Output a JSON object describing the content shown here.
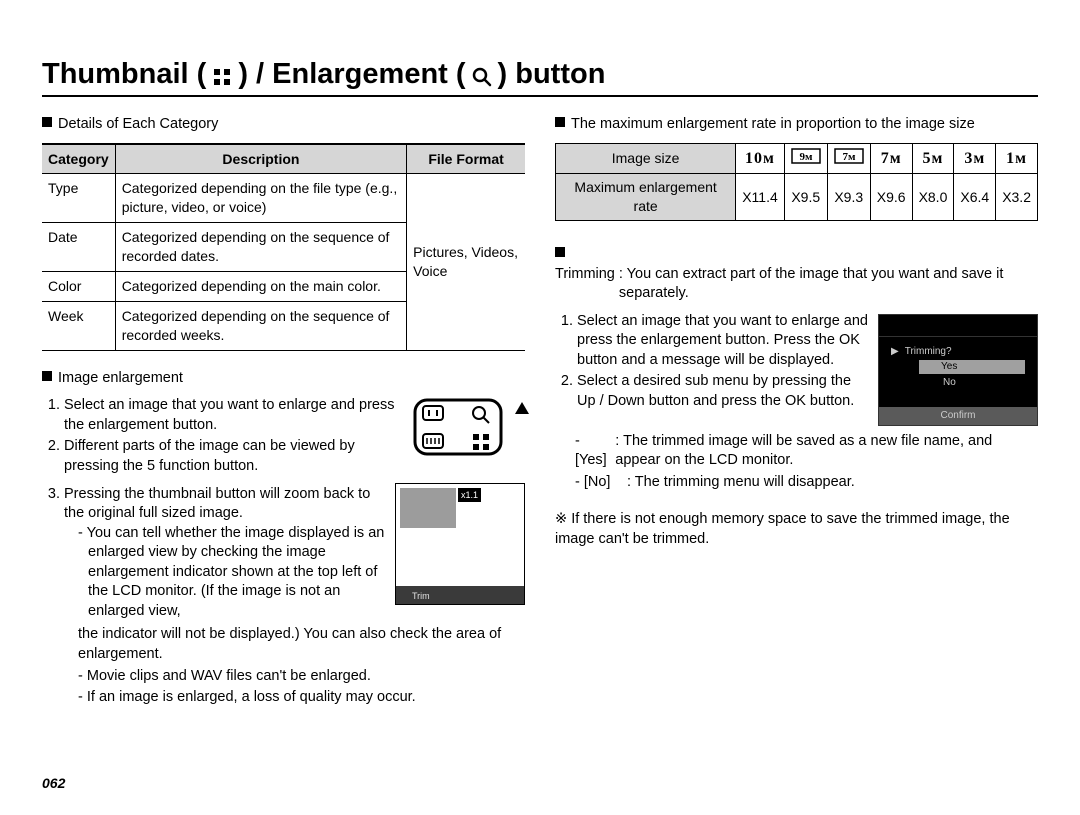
{
  "title_parts": {
    "a": "Thumbnail (",
    "b": ") / Enlargement (",
    "c": ") button"
  },
  "left": {
    "heading1": "Details of Each Category",
    "table_headers": [
      "Category",
      "Description",
      "File Format"
    ],
    "rows": [
      {
        "cat": "Type",
        "desc": "Categorized depending on the file type (e.g., picture, video, or voice)"
      },
      {
        "cat": "Date",
        "desc": "Categorized depending on the sequence of recorded dates."
      },
      {
        "cat": "Color",
        "desc": "Categorized depending on the main color."
      },
      {
        "cat": "Week",
        "desc": "Categorized depending on the sequence of recorded weeks."
      }
    ],
    "file_format": "Pictures, Videos, Voice",
    "heading2": "Image enlargement",
    "step1": "Select an image that you want to enlarge and press the enlargement button.",
    "step2": "Different parts of the image can be viewed by pressing the 5 function button.",
    "step3": "Pressing the thumbnail button will zoom back to the original full sized image.",
    "sub1": "You can tell whether the image displayed is an enlarged view by checking the image enlargement indicator shown at the top left of the LCD monitor. (If the image is not an enlarged view,",
    "sub1b": "the indicator will not be displayed.) You can also check the area of enlargement.",
    "sub2": "Movie clips and WAV files can't be enlarged.",
    "sub3": "If an image is enlarged, a loss of quality may occur.",
    "lcd_zoom": "x1.1",
    "lcd_trim_label": "Trim"
  },
  "right": {
    "heading1": "The maximum enlargement rate in proportion to the image size",
    "row1_label": "Image size",
    "sizes": [
      "10ᴍ",
      "9ᴍ",
      "7ᴍ",
      "7ᴍ",
      "5ᴍ",
      "3ᴍ",
      "1ᴍ"
    ],
    "row2_label": "Maximum enlargement rate",
    "rates": [
      "X11.4",
      "X9.5",
      "X9.3",
      "X9.6",
      "X8.0",
      "X6.4",
      "X3.2"
    ],
    "trim_lead": "Trimming",
    "trim_body": ": You can extract part of the image that you want and save it separately.",
    "step1": "Select an image that you want to enlarge and press the enlargement button. Press the OK button and a message will be displayed.",
    "step2": "Select a desired sub menu by pressing the Up / Down button and press the OK button.",
    "yes_label": "- [Yes]",
    "yes_text": ": The trimmed image will be saved as a new file name, and appear on the LCD monitor.",
    "no_label": "- [No]",
    "no_text": ": The trimming menu will disappear.",
    "note_symbol": "※",
    "note": "If there is not enough memory space to save the trimmed image, the image can't be trimmed.",
    "dlg_title": "Trimming?",
    "dlg_yes": "Yes",
    "dlg_no": "No",
    "dlg_confirm": "Confirm"
  },
  "page": "062"
}
